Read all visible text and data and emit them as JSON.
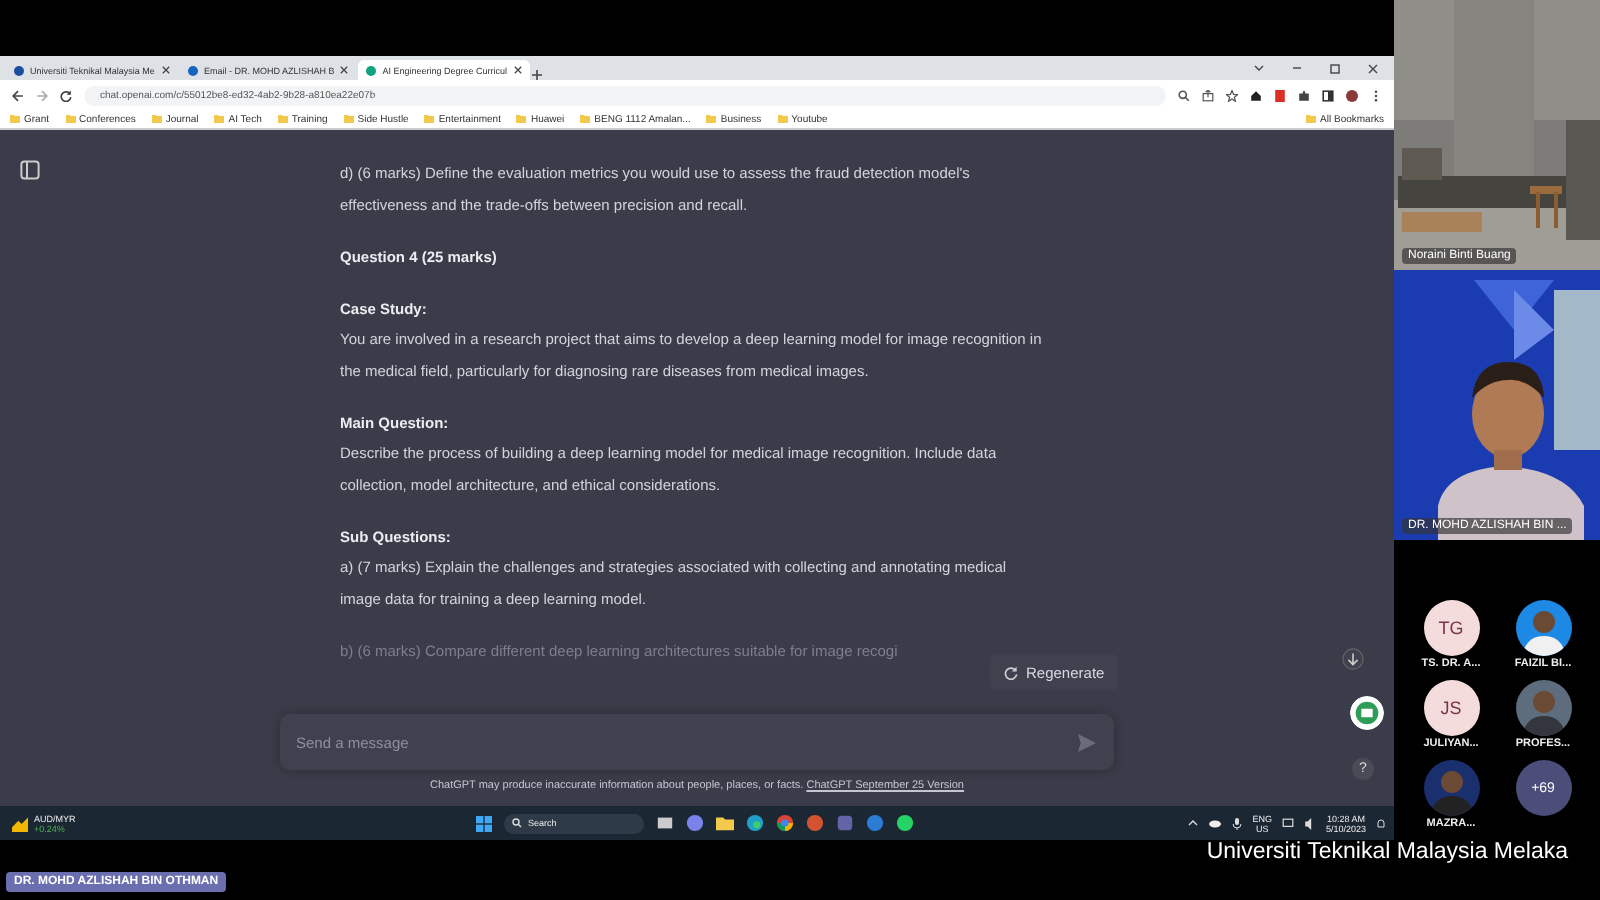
{
  "browser": {
    "tabs": [
      {
        "title": "Universiti Teknikal Malaysia Me",
        "selected": false
      },
      {
        "title": "Email - DR. MOHD AZLISHAH B",
        "selected": false
      },
      {
        "title": "AI Engineering Degree Curricul",
        "selected": true
      }
    ],
    "url": "chat.openai.com/c/55012be8-ed32-4ab2-9b28-a810ea22e07b",
    "bookmarks": [
      "Grant",
      "Conferences",
      "Journal",
      "AI Tech",
      "Training",
      "Side Hustle",
      "Entertainment",
      "Huawei",
      "BENG 1112 Amalan...",
      "Business",
      "Youtube"
    ],
    "all_bookmarks": "All Bookmarks"
  },
  "chat": {
    "paragraphs": [
      {
        "kind": "body",
        "text": "d) (6 marks) Define the evaluation metrics you would use to assess the fraud detection model's effectiveness and the trade-offs between precision and recall."
      },
      {
        "kind": "heading",
        "text": "Question 4 (25 marks)"
      },
      {
        "kind": "heading",
        "text": "Case Study:"
      },
      {
        "kind": "body",
        "text": "You are involved in a research project that aims to develop a deep learning model for image recognition in the medical field, particularly for diagnosing rare diseases from medical images."
      },
      {
        "kind": "heading",
        "text": "Main Question:"
      },
      {
        "kind": "body",
        "text": "Describe the process of building a deep learning model for medical image recognition. Include data collection, model architecture, and ethical considerations."
      },
      {
        "kind": "heading",
        "text": "Sub Questions:"
      },
      {
        "kind": "body",
        "text": "a) (7 marks) Explain the challenges and strategies associated with collecting and annotating medical image data for training a deep learning model."
      },
      {
        "kind": "faded",
        "text": "b) (6 marks) Compare different deep learning architectures suitable for image recogi"
      }
    ],
    "regenerate": "Regenerate",
    "input": {
      "placeholder": "Send a message"
    },
    "disclaimer": "ChatGPT may produce inaccurate information about people, places, or facts.",
    "version_link": "ChatGPT September 25 Version",
    "help": "?"
  },
  "taskbar": {
    "ticker": {
      "name": "AUD/MYR",
      "change": "+0.24%"
    },
    "search": {
      "placeholder": "Search"
    },
    "language": "ENG",
    "region": "US",
    "time": "10:28 AM",
    "date": "5/10/2023"
  },
  "presenter_label": "DR. MOHD AZLISHAH BIN OTHMAN",
  "caption": "Universiti Teknikal Malaysia Melaka",
  "participants": {
    "videos": [
      {
        "kind": "room",
        "name": "Noraini Binti Buang"
      },
      {
        "kind": "person",
        "name": "DR. MOHD AZLISHAH BIN ..."
      }
    ],
    "avatars": [
      {
        "kind": "initials",
        "initials": "TG",
        "name": "TS. DR. A..."
      },
      {
        "name": "FAIZIL BI..."
      },
      {
        "kind": "initials",
        "initials": "JS",
        "name": "JULIYAN..."
      },
      {
        "name": "PROFES..."
      },
      {
        "name": "MAZRA..."
      },
      {
        "kind": "more",
        "initials": "+69"
      }
    ]
  }
}
